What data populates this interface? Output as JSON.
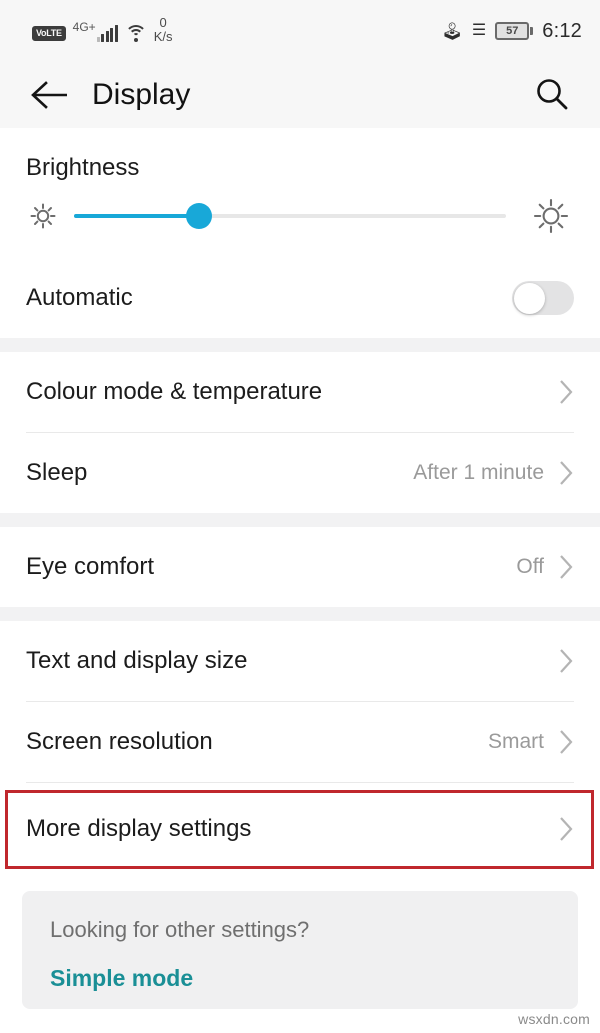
{
  "statusbar": {
    "volte_badge": "VoLTE",
    "network_type": "4G+",
    "wifi_icon": "wifi-icon",
    "datarate_value": "0",
    "datarate_unit": "K/s",
    "bluetooth_icon": "bluetooth-icon",
    "vibrate_icon": "vibrate-icon",
    "battery_percent": "57",
    "time": "6:12"
  },
  "appbar": {
    "back_icon": "back-arrow-icon",
    "title": "Display",
    "search_icon": "search-icon"
  },
  "brightness": {
    "title": "Brightness",
    "low_icon": "sun-small-icon",
    "high_icon": "sun-large-icon",
    "slider_percent": 29,
    "accent_color": "#18a8d8"
  },
  "automatic": {
    "label": "Automatic",
    "state": "off"
  },
  "rows": [
    {
      "label": "Colour mode & temperature",
      "value": ""
    },
    {
      "label": "Sleep",
      "value": "After 1 minute"
    },
    {
      "label": "Eye comfort",
      "value": "Off"
    },
    {
      "label": "Text and display size",
      "value": ""
    },
    {
      "label": "Screen resolution",
      "value": "Smart"
    },
    {
      "label": "More display settings",
      "value": ""
    }
  ],
  "highlight": {
    "target": "More display settings",
    "box_color": "#c0282d"
  },
  "footer": {
    "question": "Looking for other settings?",
    "link": "Simple mode",
    "link_color": "#1a8f96"
  },
  "watermark": "wsxdn.com"
}
